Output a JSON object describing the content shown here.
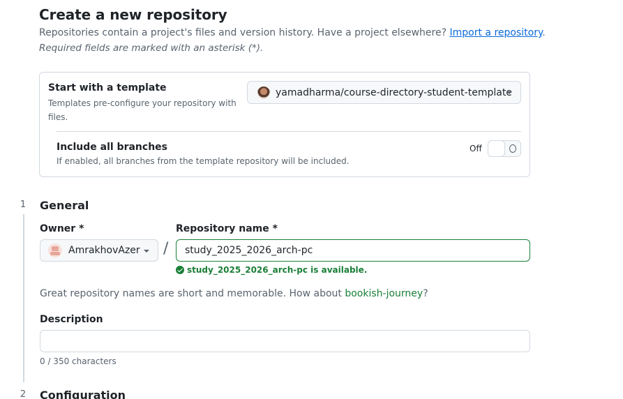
{
  "header": {
    "title": "Create a new repository",
    "subtitle": "Repositories contain a project's files and version history. Have a project elsewhere?",
    "import_link": "Import a repository",
    "subtitle_end": ".",
    "required_note": "Required fields are marked with an asterisk (*)."
  },
  "template": {
    "title": "Start with a template",
    "description": "Templates pre-configure your repository with files.",
    "selected": "yamadharma/course-directory-student-template",
    "branches_title": "Include all branches",
    "branches_description": "If enabled, all branches from the template repository will be included.",
    "toggle_label": "Off",
    "toggle_on": false
  },
  "general": {
    "step": "1",
    "title": "General",
    "owner_label": "Owner *",
    "owner_value": "AmrakhovAzer",
    "separator": "/",
    "repo_label": "Repository name *",
    "repo_value": "study_2025_2026_arch-pc",
    "availability": "study_2025_2026_arch-pc is available.",
    "suggest_text": "Great repository names are short and memorable. How about",
    "suggest_name": "bookish-journey",
    "suggest_end": "?",
    "description_label": "Description",
    "description_value": "",
    "char_count": "0 / 350 characters"
  },
  "configuration": {
    "step": "2",
    "title": "Configuration"
  },
  "colors": {
    "success": "#1a7f37",
    "link": "#0969da",
    "border": "#d1d9e0",
    "muted": "#59636e"
  }
}
